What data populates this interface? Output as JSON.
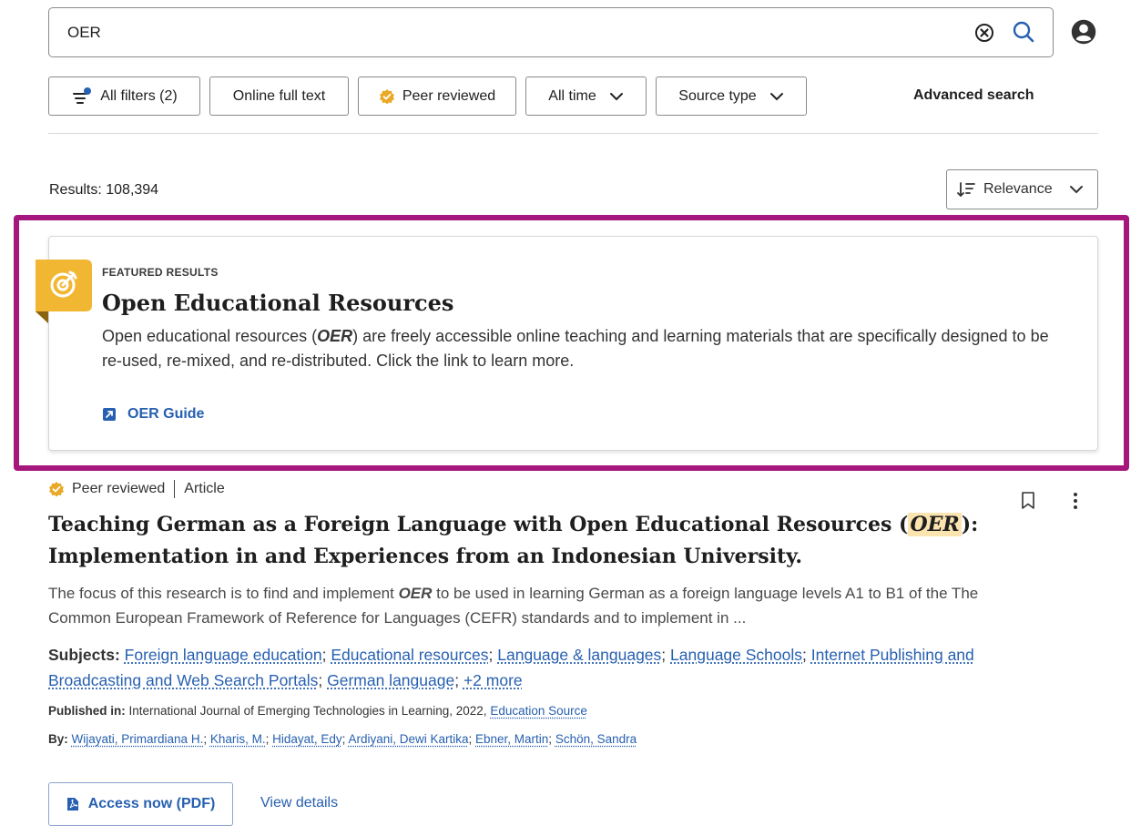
{
  "search": {
    "query": "OER"
  },
  "filters": {
    "all_filters": "All filters (2)",
    "online_full_text": "Online full text",
    "peer_reviewed": "Peer reviewed",
    "all_time": "All time",
    "source_type": "Source type",
    "advanced_search": "Advanced search"
  },
  "results": {
    "count": "Results: 108,394",
    "sort_label": "Relevance"
  },
  "featured": {
    "label": "FEATURED RESULTS",
    "title": "Open Educational Resources",
    "desc_part1": "Open educational resources (",
    "desc_hl": "OER",
    "desc_part2": ") are freely accessible online teaching and learning materials that are specifically designed to be re-used, re-mixed, and re-distributed. Click the link to learn more.",
    "link": "OER Guide"
  },
  "result": {
    "peer_reviewed": "Peer reviewed",
    "type": "Article",
    "title_part1": "Teaching German as a Foreign Language with Open Educational Resources (",
    "title_hl": "OER",
    "title_part2": "): Implementation in and Experiences from an Indonesian University.",
    "abstract_part1": "The focus of this research is to find and implement ",
    "abstract_hl": "OER",
    "abstract_part2": " to be used in learning German as a foreign language levels A1 to B1 of the The Common European Framework of Reference for Languages (CEFR) standards and to implement in ...",
    "subjects_label": "Subjects:",
    "subjects": [
      "Foreign language education",
      "Educational resources",
      "Language & languages",
      "Language Schools",
      "Internet Publishing and Broadcasting and Web Search Portals",
      "German language"
    ],
    "subjects_more": "+2 more",
    "published_label": "Published in:",
    "published_text": "International Journal of Emerging Technologies in Learning, 2022,",
    "published_source": "Education Source",
    "by_label": "By:",
    "authors": [
      "Wijayati, Primardiana H.",
      "Kharis, M.",
      "Hidayat, Edy",
      "Ardiyani, Dewi Kartika",
      "Ebner, Martin",
      "Schön, Sandra"
    ],
    "access_btn": "Access now (PDF)",
    "view_details": "View details"
  },
  "colors": {
    "highlight_frame": "#a5177c",
    "featured_badge": "#f2b732",
    "link": "#2760b0",
    "peer_badge": "#e9a825",
    "term_highlight": "#fce4b0"
  },
  "icons": [
    "clear-icon",
    "search-icon",
    "user-account-icon",
    "filter-icon",
    "peer-reviewed-badge-icon",
    "chevron-down-icon",
    "sort-icon",
    "featured-target-icon",
    "external-link-icon",
    "bookmark-icon",
    "more-options-icon",
    "pdf-icon"
  ]
}
